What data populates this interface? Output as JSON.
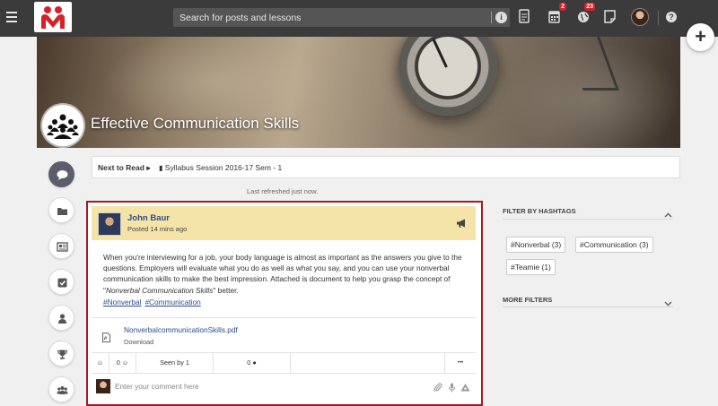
{
  "topbar": {
    "search_placeholder": "Search for posts and lessons",
    "calendar_badge": "2",
    "globe_badge": "23"
  },
  "course": {
    "title": "Effective Communication Skills"
  },
  "next_read": {
    "label": "Next to Read",
    "item": "Syllabus Session 2016-17 Sem - 1"
  },
  "refresh_status": "Last refreshed just now.",
  "post": {
    "author": "John Baur",
    "time": "Posted 14 mins ago",
    "body_before_italic": "When you're interviewing for a job, your body language is almost as important as the answers you give to the questions. Employers will evaluate what you do as well as what you say, and you can use your nonverbal communication skills to make the best impression. Attached is document to help you grasp the concept of \"",
    "body_italic": "Nonverbal Communication Skills",
    "body_after_italic": "\" better.",
    "hashtags": [
      "#Nonverbal",
      "#Communication"
    ],
    "attachment": {
      "name": "NonverbalcommunicationSkills.pdf",
      "action": "Download"
    },
    "stats": {
      "reactions": "0",
      "seen_by": "Seen by 1",
      "comments": "0",
      "more": "•••"
    },
    "comment_placeholder": "Enter your comment here"
  },
  "filters": {
    "hashtags_title": "FILTER BY HASHTAGS",
    "tags": [
      "#Nonverbal (3)",
      "#Communication (3)",
      "#Teamie (1)"
    ],
    "more_title": "MORE FILTERS"
  },
  "colors": {
    "topbar": "#3b3b3b",
    "accent_red": "#a31c25",
    "link_blue": "#2a4d8f",
    "post_header": "#f5e4a7"
  }
}
